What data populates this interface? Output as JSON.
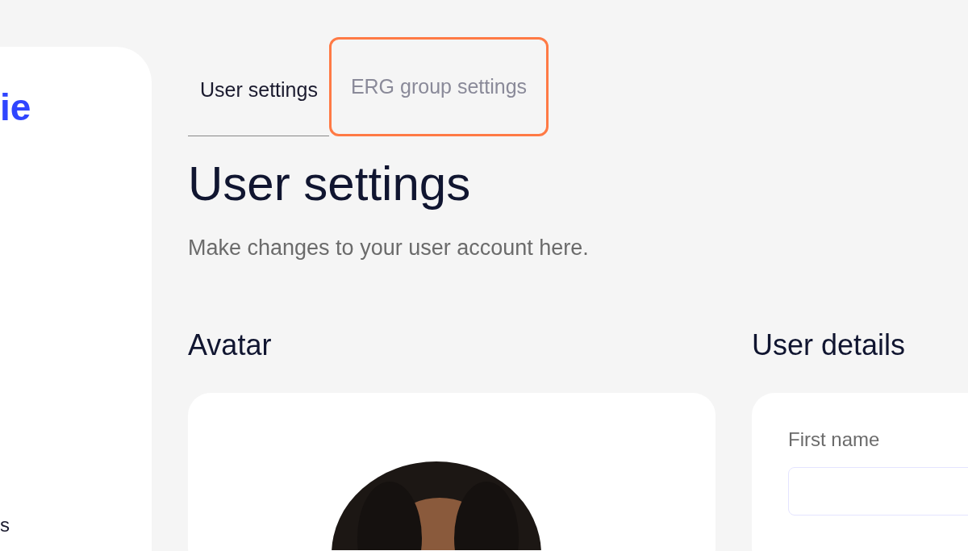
{
  "sidebar": {
    "logo": "ie",
    "items": [
      {
        "label": "s"
      }
    ]
  },
  "tabs": [
    {
      "label": "User settings",
      "selected": true,
      "highlighted": false
    },
    {
      "label": "ERG group settings",
      "selected": false,
      "highlighted": true
    }
  ],
  "page": {
    "title": "User settings",
    "subtitle": "Make changes to your user account here."
  },
  "avatar": {
    "heading": "Avatar"
  },
  "user_details": {
    "heading": "User details",
    "fields": [
      {
        "label": "First name"
      }
    ]
  }
}
